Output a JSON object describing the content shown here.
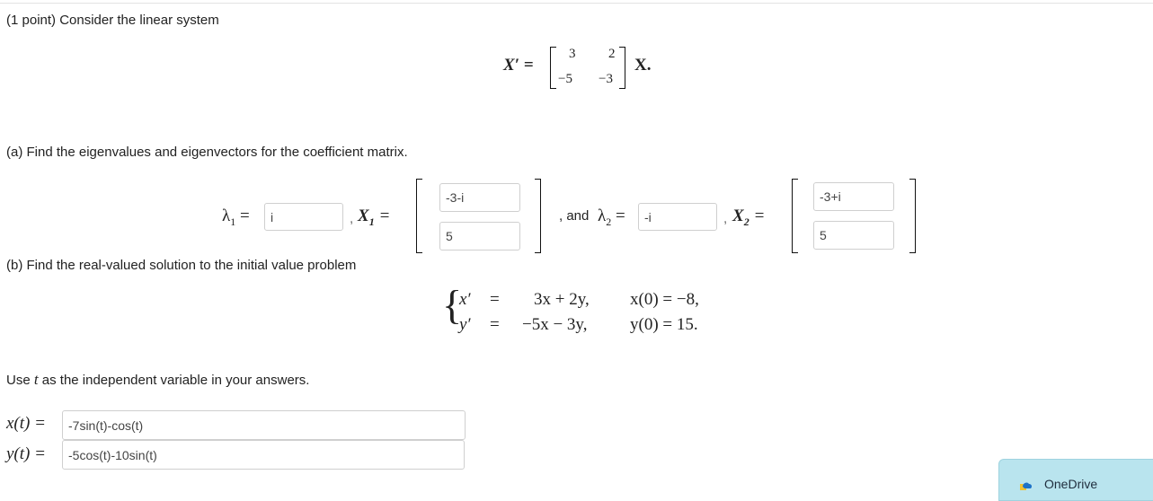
{
  "intro": "(1 point) Consider the linear system",
  "system": {
    "lhs": "X′ =",
    "matrix": [
      [
        "3",
        "2"
      ],
      [
        "−5",
        "−3"
      ]
    ],
    "rhs": "X."
  },
  "part_a": {
    "prompt": "(a) Find the eigenvalues and eigenvectors for the coefficient matrix.",
    "lambda1_label": "λ",
    "lambda1_sub": "1",
    "equals": "=",
    "lambda1_value": "i",
    "comma": ",",
    "X1_label": "X",
    "X1_sub": "1",
    "X1_values": [
      "-3-i",
      "5"
    ],
    "and_text": ", and",
    "lambda2_label": "λ",
    "lambda2_sub": "2",
    "lambda2_value": "-i",
    "X2_label": "X",
    "X2_sub": "2",
    "X2_values": [
      "-3+i",
      "5"
    ]
  },
  "part_b": {
    "prompt": "(b) Find the real-valued solution to the initial value problem",
    "rows": [
      {
        "lhs": "x′",
        "eq": "=",
        "rhs": "3x + 2y,",
        "ic": "x(0) = −8,"
      },
      {
        "lhs": "y′",
        "eq": "=",
        "rhs": "−5x − 3y,",
        "ic": "y(0) = 15."
      }
    ],
    "use_text_pre": "Use",
    "use_var": "t",
    "use_text_post": "as the independent variable in your answers.",
    "x_label": "x(t) =",
    "x_value": "-7sin(t)-cos(t)",
    "y_label": "y(t) =",
    "y_value": "-5cos(t)-10sin(t)"
  },
  "onedrive": {
    "label": "OneDrive",
    "icon": "onedrive-cloud-icon"
  }
}
